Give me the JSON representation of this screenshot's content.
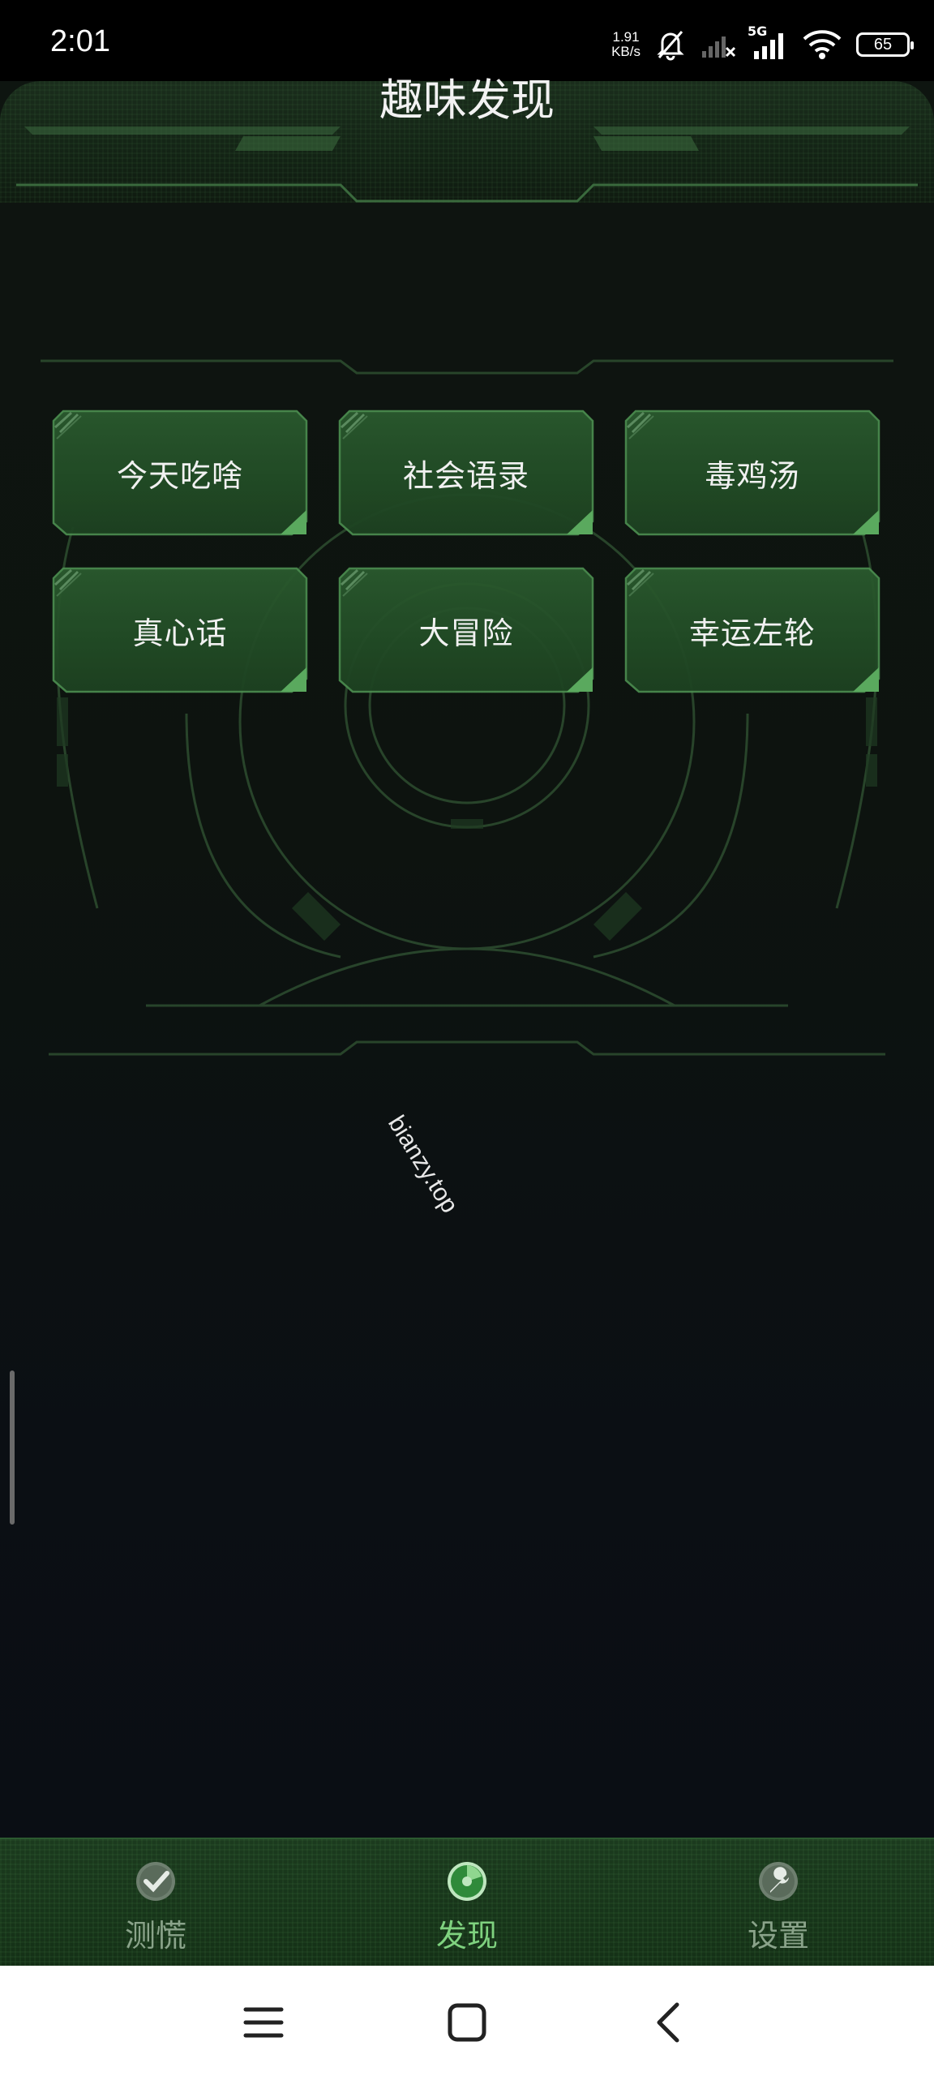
{
  "status_bar": {
    "time": "2:01",
    "net_speed_value": "1.91",
    "net_speed_unit": "KB/s",
    "network_type": "5G",
    "battery": "65",
    "icons": [
      "mute-bell-icon",
      "signal-weak-icon",
      "signal-5g-icon",
      "wifi-icon",
      "battery-icon"
    ]
  },
  "header": {
    "title": "趣味发现"
  },
  "fun_grid": {
    "items": [
      {
        "label": "今天吃啥"
      },
      {
        "label": "社会语录"
      },
      {
        "label": "毒鸡汤"
      },
      {
        "label": "真心话"
      },
      {
        "label": "大冒险"
      },
      {
        "label": "幸运左轮"
      }
    ]
  },
  "watermark": "bianzy.top",
  "tab_bar": {
    "tabs": [
      {
        "label": "测慌",
        "icon": "check-badge-icon",
        "active": false
      },
      {
        "label": "发现",
        "icon": "radar-icon",
        "active": true
      },
      {
        "label": "设置",
        "icon": "wrench-icon",
        "active": false
      }
    ]
  },
  "system_nav": {
    "icons": [
      "menu-icon",
      "home-icon",
      "back-icon"
    ]
  },
  "colors": {
    "button_green": "#25502a",
    "button_border": "#4a8a4e",
    "active_tab": "#7fd27f",
    "inactive_tab": "#8aa38a",
    "tab_bar_bg": "#173419"
  }
}
